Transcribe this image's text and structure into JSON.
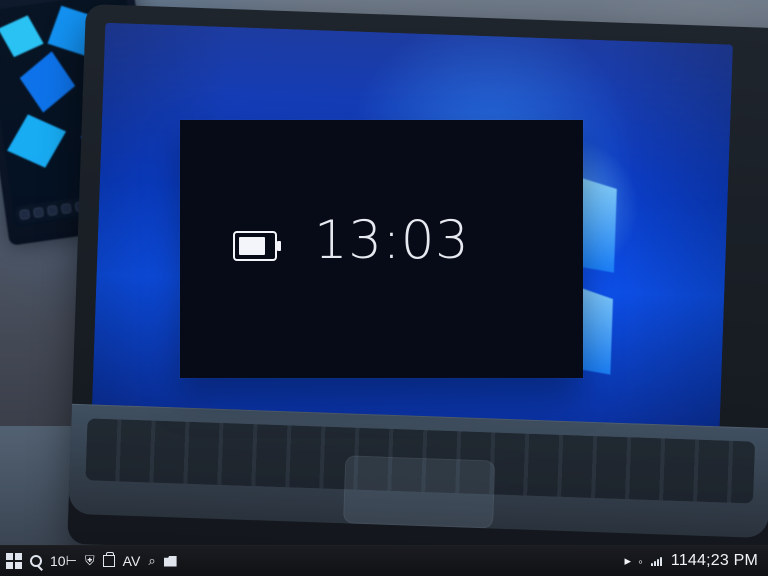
{
  "overlay": {
    "time": "13:03"
  },
  "taskbar": {
    "inline_label": "10",
    "center_glyph": "AV",
    "tray_left": "▸",
    "tray_mid": "◦",
    "clock": "1144;23 PM"
  },
  "icons": {
    "start": "start-icon",
    "search": "search-icon",
    "shield": "shield-icon",
    "box": "box-icon",
    "text": "text-icon",
    "folder": "folder-icon",
    "signal": "signal-icon",
    "battery": "battery-icon"
  },
  "colors": {
    "overlay_bg": "#070b17",
    "overlay_text": "#e6e9ef",
    "screen_blue": "#0d51ee",
    "taskbar_bg": "#101114"
  }
}
